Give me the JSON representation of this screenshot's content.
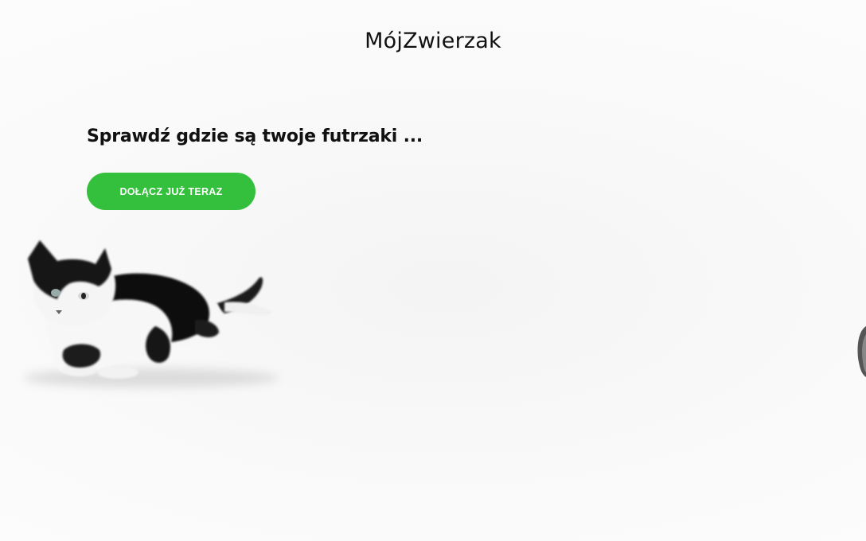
{
  "header": {
    "brand": "MójZwierzak"
  },
  "hero": {
    "headline": "Sprawdź gdzie są twoje futrzaki ...",
    "cta_label": "DOŁĄCZ JUŻ TERAZ"
  },
  "theme": {
    "accent": "#34c03c",
    "text": "#111111",
    "background": "#fbfbfb"
  },
  "icons": [
    "cat-photo",
    "pet-photo-edge"
  ]
}
